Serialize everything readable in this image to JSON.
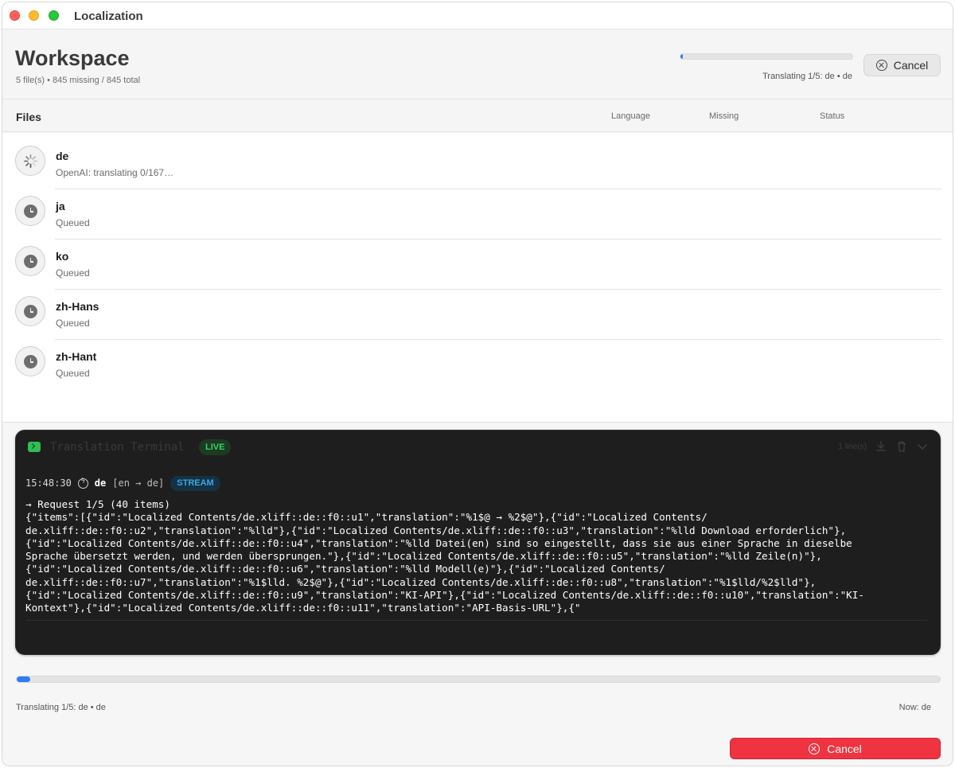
{
  "window": {
    "title": "Localization"
  },
  "header": {
    "title": "Workspace",
    "subtitle": "5 file(s) • 845 missing / 845 total",
    "progress": 0.01,
    "status": "Translating 1/5: de • de",
    "cancel_label": "Cancel"
  },
  "columns": {
    "files": "Files",
    "language": "Language",
    "missing": "Missing",
    "status": "Status"
  },
  "files": [
    {
      "name": "de",
      "status": "OpenAI: translating 0/167…",
      "state": "in-progress"
    },
    {
      "name": "ja",
      "status": "Queued",
      "state": "queued"
    },
    {
      "name": "ko",
      "status": "Queued",
      "state": "queued"
    },
    {
      "name": "zh-Hans",
      "status": "Queued",
      "state": "queued"
    },
    {
      "name": "zh-Hant",
      "status": "Queued",
      "state": "queued"
    }
  ],
  "terminal": {
    "title": "Translation Terminal",
    "live_label": "LIVE",
    "line_count": "1 line(s)",
    "entry": {
      "time": "15:48:30",
      "lang": "de",
      "pair": "[en → de]",
      "badge": "STREAM",
      "text": "→ Request 1/5 (40 items)\n{\"items\":[{\"id\":\"Localized Contents/de.xliff::de::f0::u1\",\"translation\":\"%1$@ → %2$@\"},{\"id\":\"Localized Contents/\nde.xliff::de::f0::u2\",\"translation\":\"%lld\"},{\"id\":\"Localized Contents/de.xliff::de::f0::u3\",\"translation\":\"%lld Download erforderlich\"},\n{\"id\":\"Localized Contents/de.xliff::de::f0::u4\",\"translation\":\"%lld Datei(en) sind so eingestellt, dass sie aus einer Sprache in dieselbe\nSprache übersetzt werden, und werden übersprungen.\"},{\"id\":\"Localized Contents/de.xliff::de::f0::u5\",\"translation\":\"%lld Zeile(n)\"},\n{\"id\":\"Localized Contents/de.xliff::de::f0::u6\",\"translation\":\"%lld Modell(e)\"},{\"id\":\"Localized Contents/\nde.xliff::de::f0::u7\",\"translation\":\"%1$lld. %2$@\"},{\"id\":\"Localized Contents/de.xliff::de::f0::u8\",\"translation\":\"%1$lld/%2$lld\"},\n{\"id\":\"Localized Contents/de.xliff::de::f0::u9\",\"translation\":\"KI-API\"},{\"id\":\"Localized Contents/de.xliff::de::f0::u10\",\"translation\":\"KI-\nKontext\"},{\"id\":\"Localized Contents/de.xliff::de::f0::u11\",\"translation\":\"API-Basis-URL\"},{\""
    }
  },
  "footer": {
    "progress": 0.01,
    "status": "Translating 1/5: de • de",
    "now": "Now: de",
    "cancel_label": "Cancel"
  },
  "colors": {
    "accent": "#2f7cf6",
    "danger": "#ef3340",
    "live": "#3bd06a",
    "stream": "#3aa8e0"
  }
}
